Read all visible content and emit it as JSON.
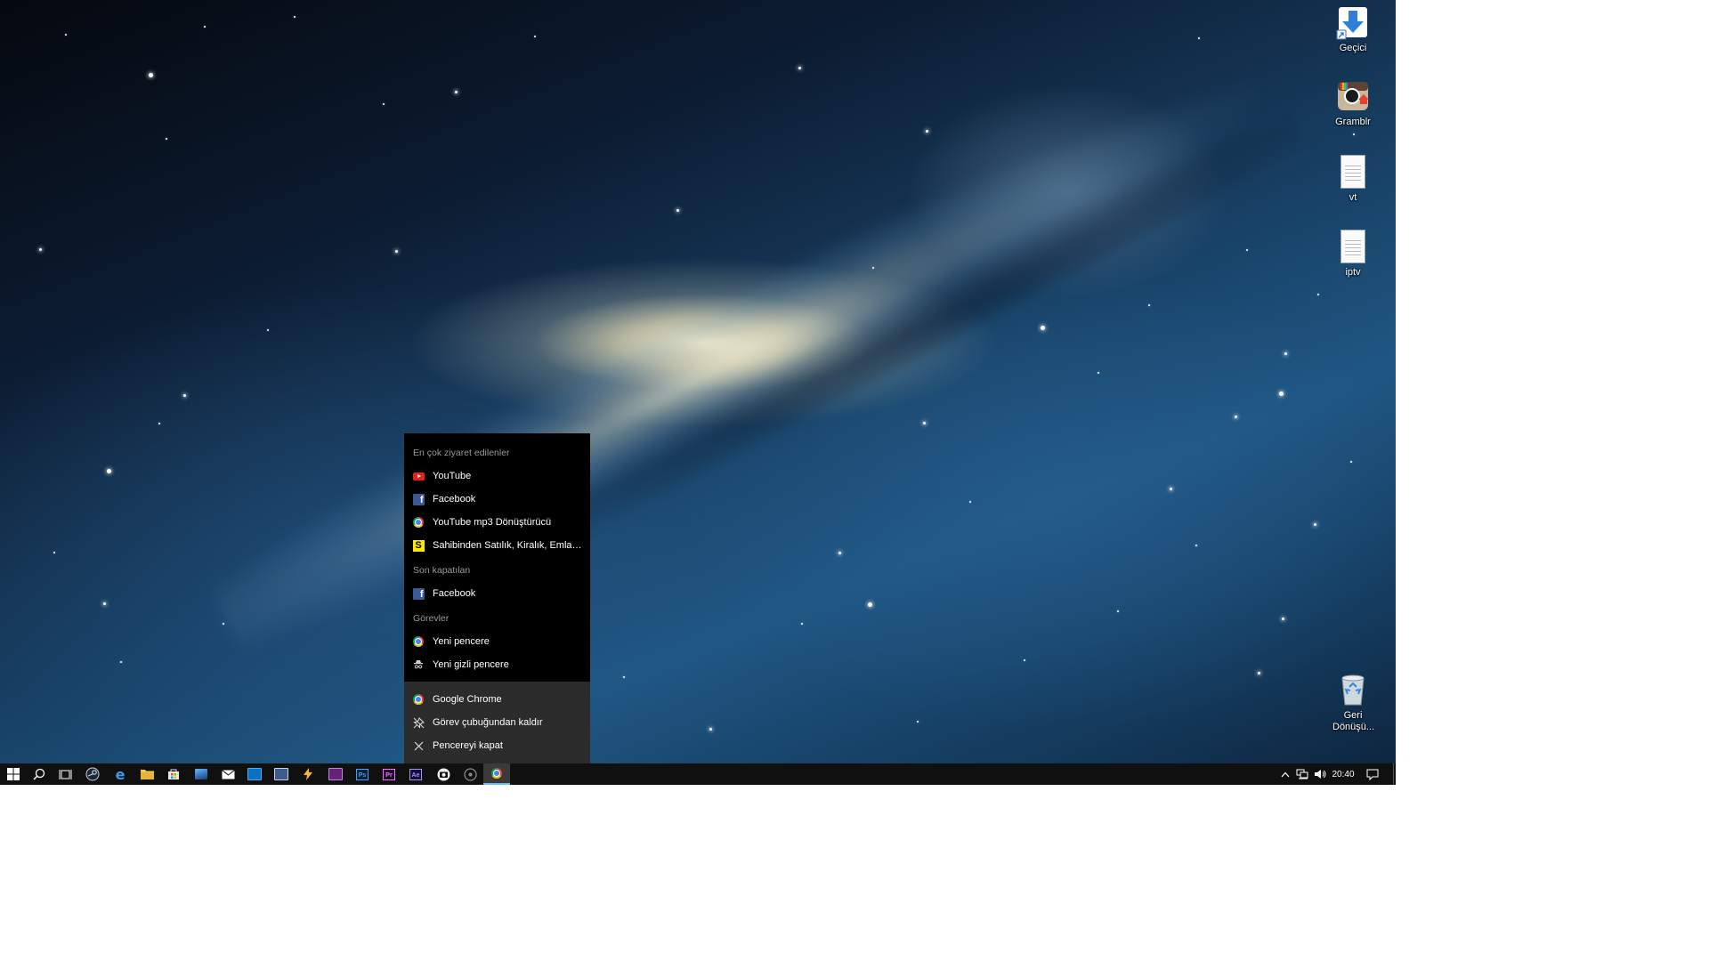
{
  "desktop": {
    "icons": [
      {
        "name": "gecici",
        "label": "Geçici"
      },
      {
        "name": "gramblr",
        "label": "Gramblr"
      },
      {
        "name": "vt",
        "label": "vt"
      },
      {
        "name": "iptv",
        "label": "iptv"
      },
      {
        "name": "recycle-bin",
        "label": "Geri Dönüşü..."
      }
    ]
  },
  "jump_list": {
    "most_visited_header": "En çok ziyaret edilenler",
    "most_visited": [
      {
        "label": "YouTube",
        "icon": "youtube-icon"
      },
      {
        "label": "Facebook",
        "icon": "facebook-icon"
      },
      {
        "label": "YouTube mp3 Dönüştürücü",
        "icon": "chrome-icon"
      },
      {
        "label": "Sahibinden Satılık, Kiralık, Emlak, Oto,...",
        "icon": "sahibinden-icon"
      }
    ],
    "recently_closed_header": "Son kapatılan",
    "recently_closed": [
      {
        "label": "Facebook",
        "icon": "facebook-icon"
      }
    ],
    "tasks_header": "Görevler",
    "tasks": [
      {
        "label": "Yeni pencere",
        "icon": "chrome-icon"
      },
      {
        "label": "Yeni gizli pencere",
        "icon": "incognito-icon"
      }
    ],
    "app_actions": [
      {
        "label": "Google Chrome",
        "icon": "chrome-icon"
      },
      {
        "label": "Görev çubuğundan kaldır",
        "icon": "unpin-icon"
      },
      {
        "label": "Pencereyi kapat",
        "icon": "close-icon"
      }
    ]
  },
  "taskbar": {
    "apps": [
      "start",
      "search",
      "task-view",
      "steam",
      "edge",
      "file-explorer",
      "store",
      "photos",
      "mail",
      "outlook",
      "terminal",
      "winamp",
      "visual-studio",
      "photoshop",
      "premiere",
      "after-effects",
      "camera",
      "media",
      "chrome"
    ],
    "photoshop_label": "Ps",
    "premiere_label": "Pr",
    "after_effects_label": "Ae",
    "clock": "20:40"
  },
  "colors": {
    "jump_list_bg": "#000000",
    "jump_list_footer_bg": "#2b2b2b",
    "header_text": "#9a9a9a",
    "taskbar_bg": "#101010",
    "active_indicator": "#76b9ed"
  }
}
